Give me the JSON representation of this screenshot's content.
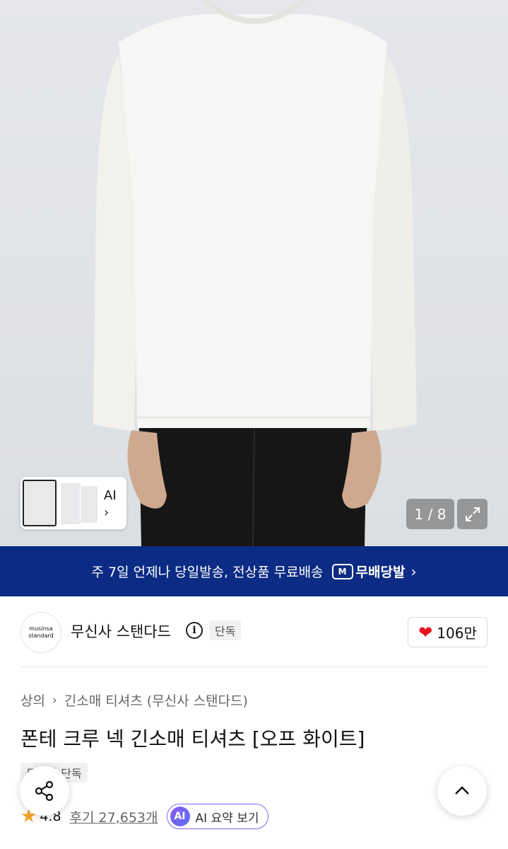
{
  "gallery": {
    "thumbnail_label": "AI",
    "counter": "1 / 8"
  },
  "banner": {
    "message": "주 7일 언제나 당일발송, 전상품 무료배송",
    "logo_badge": "M",
    "logo_text": "무배당발",
    "background_color": "#0c2b84"
  },
  "brand": {
    "logo_line1": "musinsa",
    "logo_line2": "standard",
    "name": "무신사 스탠다드",
    "info_icon": "i",
    "badge": "단독",
    "likes": "106만"
  },
  "product": {
    "breadcrumb": [
      "상의",
      "긴소매 티셔츠 (무신사 스탠다드)"
    ],
    "title": "폰테 크루 넥 긴소매 티셔츠 [오프 화이트]",
    "tags": [
      "무신사 단독"
    ],
    "rating": "4.8",
    "reviews": "후기 27,653개",
    "ai_summary": {
      "icon_label": "AI",
      "label": "AI 요약 보기"
    }
  },
  "colors": {
    "accent_purple": "#7b6cf0",
    "heart_red": "#e8131f",
    "star_orange": "#f5a623"
  }
}
